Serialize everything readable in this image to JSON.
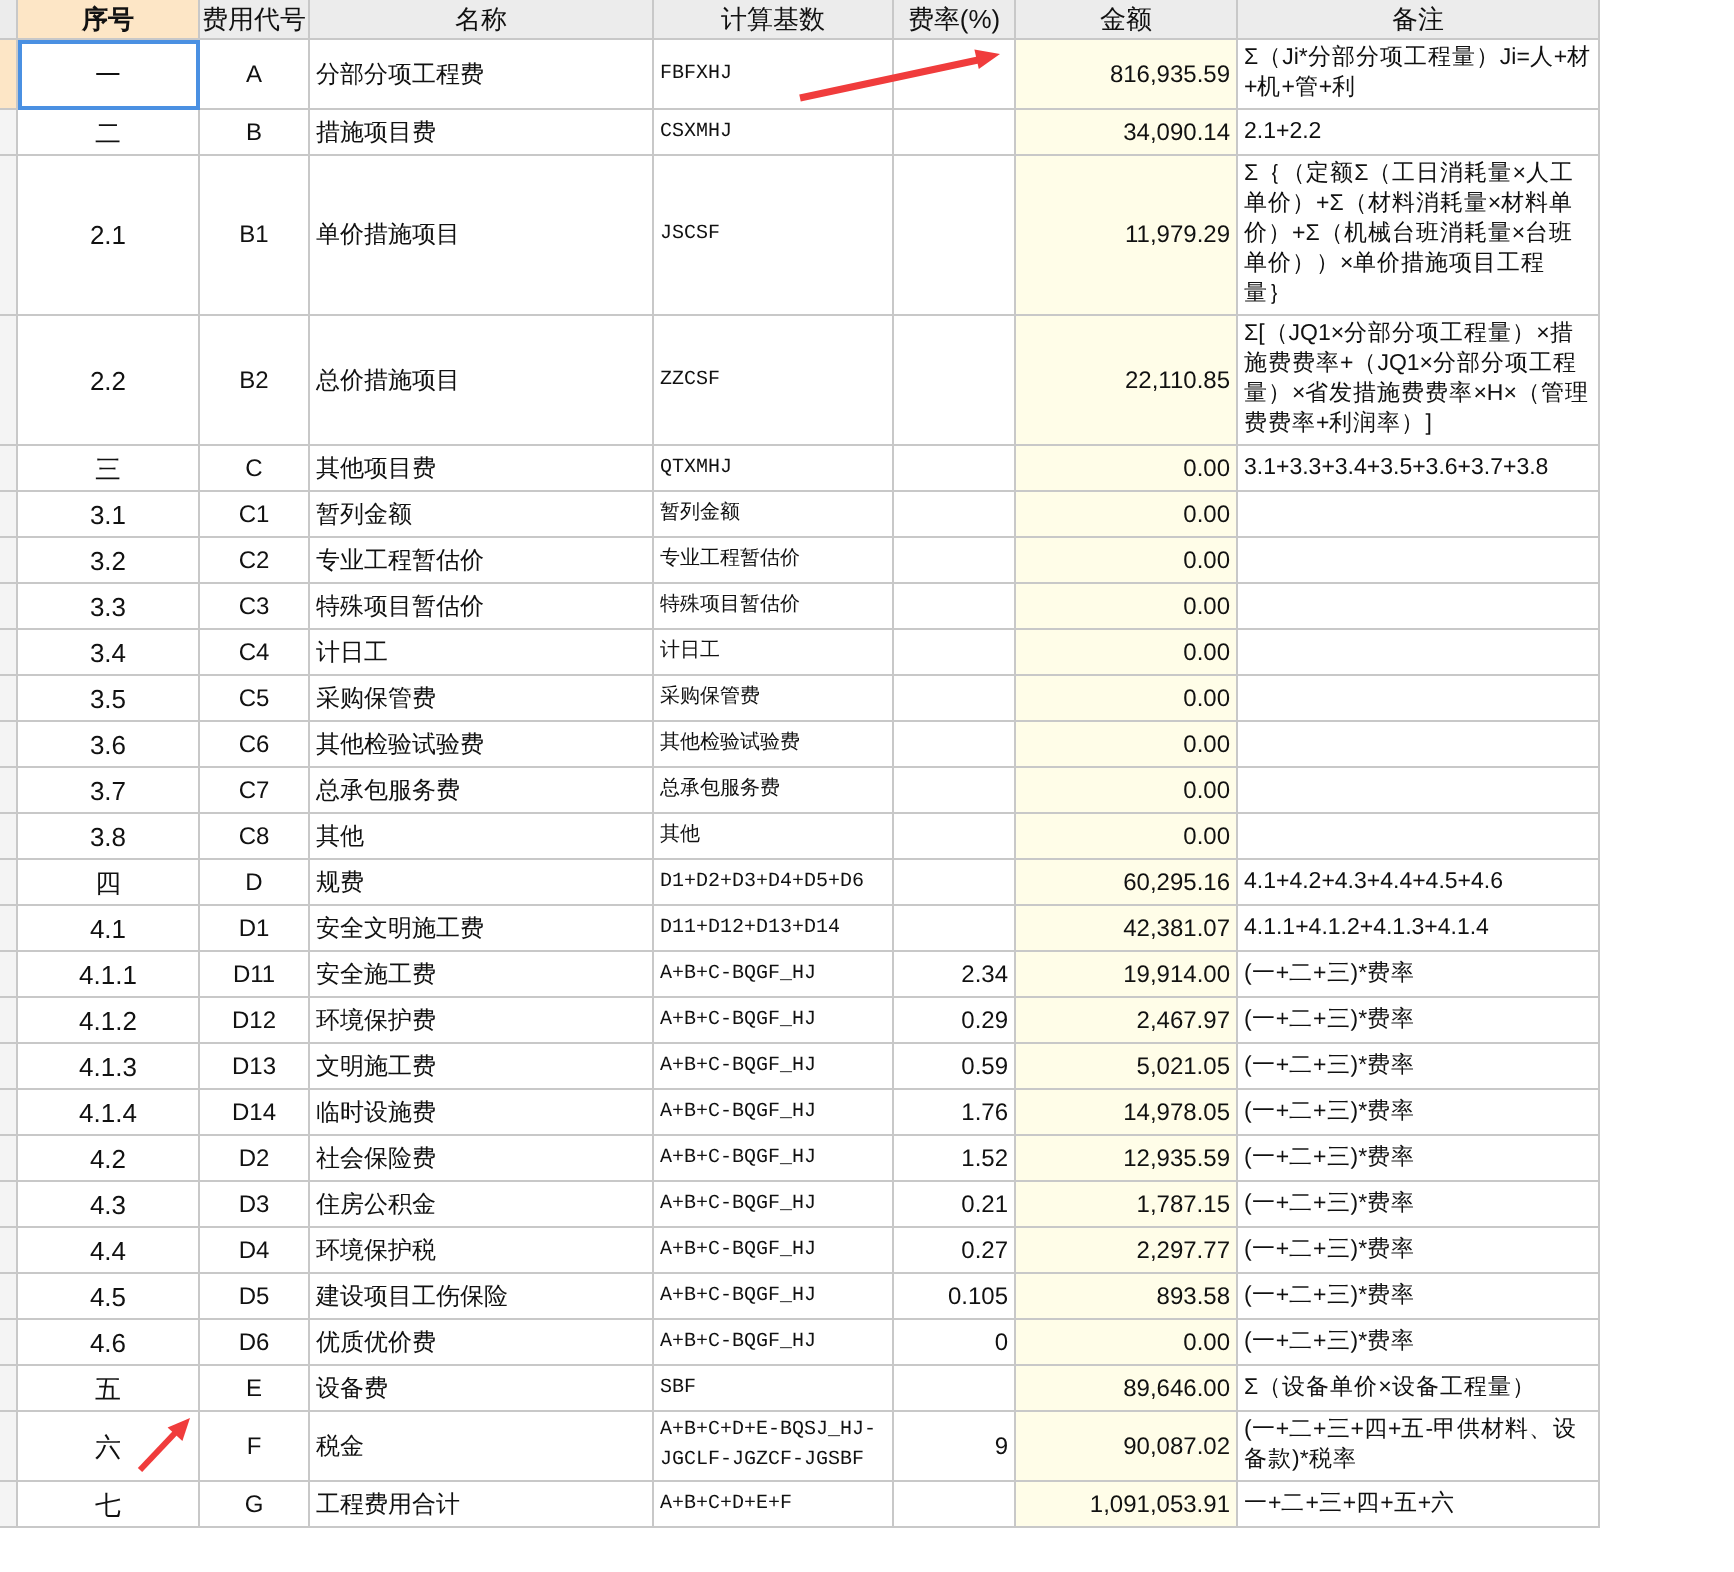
{
  "table": {
    "columns": [
      "序号",
      "费用代号",
      "名称",
      "计算基数",
      "费率(%)",
      "金额",
      "备注"
    ],
    "rows": [
      {
        "seq": "一",
        "code": "A",
        "name": "分部分项工程费",
        "base": "FBFXHJ",
        "amount": "816,935.59",
        "note": "Σ（Ji*分部分项工程量）Ji=人+材+机+管+利",
        "selected": true
      },
      {
        "seq": "二",
        "code": "B",
        "name": "措施项目费",
        "base": "CSXMHJ",
        "amount": "34,090.14",
        "note": "2.1+2.2",
        "selected": false
      },
      {
        "seq": "2.1",
        "code": "B1",
        "name": "单价措施项目",
        "base": "JSCSF",
        "amount": "11,979.29",
        "note": "Σ｛（定额Σ（工日消耗量×人工单价）+Σ（材料消耗量×材料单价）+Σ（机械台班消耗量×台班单价））×单价措施项目工程量｝",
        "selected": false
      },
      {
        "seq": "2.2",
        "code": "B2",
        "name": "总价措施项目",
        "base": "ZZCSF",
        "amount": "22,110.85",
        "note": "Σ[（JQ1×分部分项工程量）×措施费费率+（JQ1×分部分项工程量）×省发措施费费率×H×（管理费费率+利润率）]",
        "selected": false
      },
      {
        "seq": "三",
        "code": "C",
        "name": "其他项目费",
        "base": "QTXMHJ",
        "amount": "0.00",
        "note": "3.1+3.3+3.4+3.5+3.6+3.7+3.8",
        "selected": false
      },
      {
        "seq": "3.1",
        "code": "C1",
        "name": "暂列金额",
        "base": "暂列金额",
        "amount": "0.00",
        "selected": false
      },
      {
        "seq": "3.2",
        "code": "C2",
        "name": "专业工程暂估价",
        "base": "专业工程暂估价",
        "amount": "0.00",
        "selected": false
      },
      {
        "seq": "3.3",
        "code": "C3",
        "name": "特殊项目暂估价",
        "base": "特殊项目暂估价",
        "amount": "0.00",
        "selected": false
      },
      {
        "seq": "3.4",
        "code": "C4",
        "name": "计日工",
        "base": "计日工",
        "amount": "0.00",
        "selected": false
      },
      {
        "seq": "3.5",
        "code": "C5",
        "name": "采购保管费",
        "base": "采购保管费",
        "amount": "0.00",
        "selected": false
      },
      {
        "seq": "3.6",
        "code": "C6",
        "name": "其他检验试验费",
        "base": "其他检验试验费",
        "amount": "0.00",
        "selected": false
      },
      {
        "seq": "3.7",
        "code": "C7",
        "name": "总承包服务费",
        "base": "总承包服务费",
        "amount": "0.00",
        "selected": false
      },
      {
        "seq": "3.8",
        "code": "C8",
        "name": "其他",
        "base": "其他",
        "amount": "0.00",
        "selected": false
      },
      {
        "seq": "四",
        "code": "D",
        "name": "规费",
        "base": "D1+D2+D3+D4+D5+D6",
        "amount": "60,295.16",
        "note": "4.1+4.2+4.3+4.4+4.5+4.6",
        "selected": false
      },
      {
        "seq": "4.1",
        "code": "D1",
        "name": "安全文明施工费",
        "base": "D11+D12+D13+D14",
        "amount": "42,381.07",
        "note": "4.1.1+4.1.2+4.1.3+4.1.4",
        "selected": false
      },
      {
        "seq": "4.1.1",
        "code": "D11",
        "name": "安全施工费",
        "base": "A+B+C-BQGF_HJ",
        "rate": "2.34",
        "amount": "19,914.00",
        "note": "(一+二+三)*费率",
        "selected": false
      },
      {
        "seq": "4.1.2",
        "code": "D12",
        "name": "环境保护费",
        "base": "A+B+C-BQGF_HJ",
        "rate": "0.29",
        "amount": "2,467.97",
        "note": "(一+二+三)*费率",
        "selected": false
      },
      {
        "seq": "4.1.3",
        "code": "D13",
        "name": "文明施工费",
        "base": "A+B+C-BQGF_HJ",
        "rate": "0.59",
        "amount": "5,021.05",
        "note": "(一+二+三)*费率",
        "selected": false
      },
      {
        "seq": "4.1.4",
        "code": "D14",
        "name": "临时设施费",
        "base": "A+B+C-BQGF_HJ",
        "rate": "1.76",
        "amount": "14,978.05",
        "note": "(一+二+三)*费率",
        "selected": false
      },
      {
        "seq": "4.2",
        "code": "D2",
        "name": "社会保险费",
        "base": "A+B+C-BQGF_HJ",
        "rate": "1.52",
        "amount": "12,935.59",
        "note": "(一+二+三)*费率",
        "selected": false
      },
      {
        "seq": "4.3",
        "code": "D3",
        "name": "住房公积金",
        "base": "A+B+C-BQGF_HJ",
        "rate": "0.21",
        "amount": "1,787.15",
        "note": "(一+二+三)*费率",
        "selected": false
      },
      {
        "seq": "4.4",
        "code": "D4",
        "name": "环境保护税",
        "base": "A+B+C-BQGF_HJ",
        "rate": "0.27",
        "amount": "2,297.77",
        "note": "(一+二+三)*费率",
        "selected": false
      },
      {
        "seq": "4.5",
        "code": "D5",
        "name": "建设项目工伤保险",
        "base": "A+B+C-BQGF_HJ",
        "rate": "0.105",
        "amount": "893.58",
        "note": "(一+二+三)*费率",
        "selected": false
      },
      {
        "seq": "4.6",
        "code": "D6",
        "name": "优质优价费",
        "base": "A+B+C-BQGF_HJ",
        "rate": "0",
        "amount": "0.00",
        "note": "(一+二+三)*费率",
        "selected": false
      },
      {
        "seq": "五",
        "code": "E",
        "name": "设备费",
        "base": "SBF",
        "amount": "89,646.00",
        "note": "Σ（设备单价×设备工程量）",
        "selected": false
      },
      {
        "seq": "六",
        "code": "F",
        "name": "税金",
        "base": "A+B+C+D+E-BQSJ_HJ-JGCLF-JGZCF-JGSBF",
        "rate": "9",
        "amount": "90,087.02",
        "note": "(一+二+三+四+五-甲供材料、设备款)*税率",
        "selected": false
      },
      {
        "seq": "七",
        "code": "G",
        "name": "工程费用合计",
        "base": "A+B+C+D+E+F",
        "amount": "1,091,053.91",
        "note": "一+二+三+四+五+六",
        "selected": false
      }
    ]
  }
}
